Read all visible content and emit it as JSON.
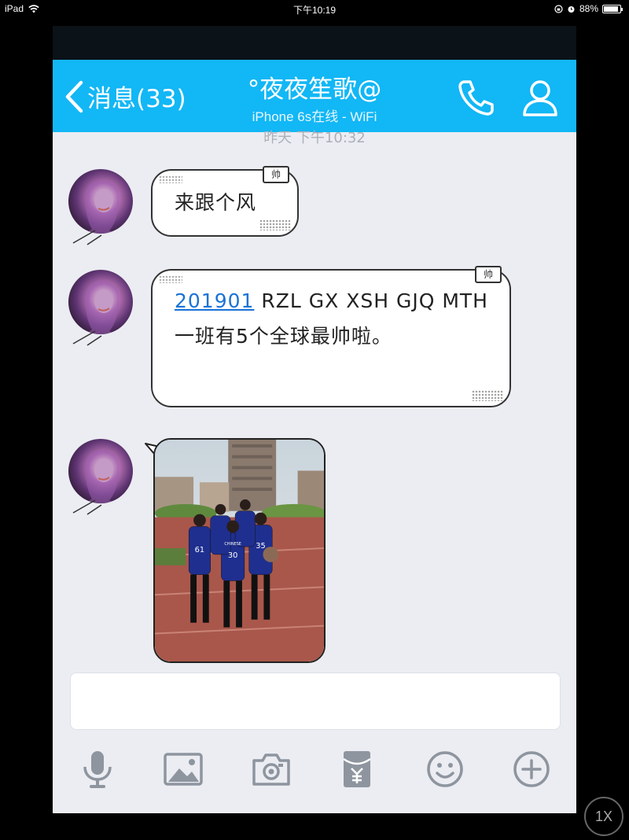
{
  "status_bar": {
    "device": "iPad",
    "time": "下午10:19",
    "battery": "88%",
    "battery_level": 0.88
  },
  "navbar": {
    "back_label": "消息(33)",
    "title": "°夜夜笙歌@",
    "subtitle": "iPhone 6s在线 - WiFi",
    "background_color": "#12b7f5"
  },
  "chat": {
    "timestamp": "昨天 下午10:32",
    "messages": [
      {
        "type": "text",
        "tag": "帅",
        "text": "来跟个风"
      },
      {
        "type": "text",
        "tag": "帅",
        "link_text": "201901",
        "text_after_link": " RZL GX XSH GJQ MTH 一班有5个全球最帅啦。"
      },
      {
        "type": "image",
        "jersey_numbers": [
          "61",
          "30",
          "35"
        ],
        "jersey_print": "CHINESE"
      }
    ]
  },
  "input": {
    "placeholder": ""
  },
  "toolbar": {
    "icons": [
      "microphone-icon",
      "image-icon",
      "camera-icon",
      "red-packet-icon",
      "emoji-icon",
      "plus-icon"
    ]
  },
  "zoom_badge": "1X"
}
